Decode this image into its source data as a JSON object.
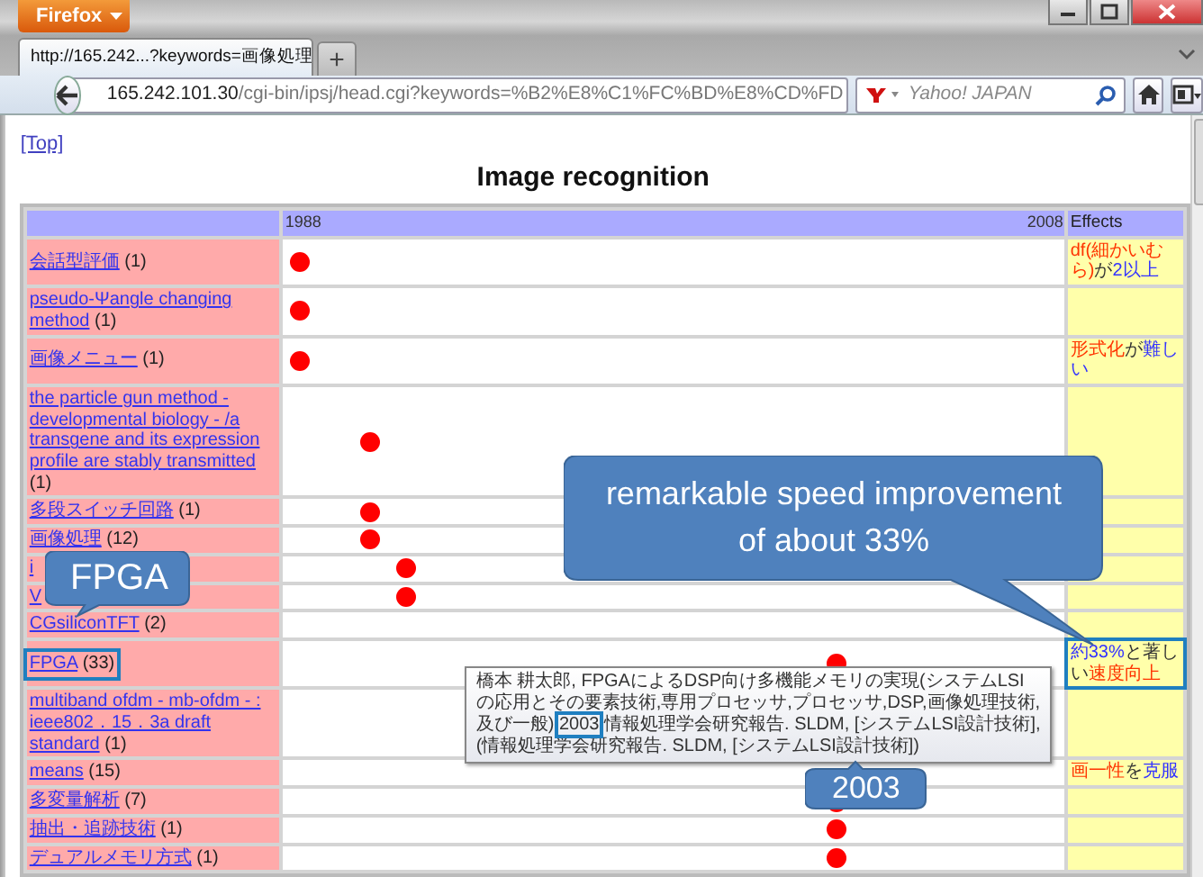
{
  "browser": {
    "menu_button": "Firefox",
    "tab": {
      "title": "http://165.242...?keywords=画像処理",
      "selected": true
    },
    "new_tab": "+",
    "url": {
      "host": "165.242.101.30",
      "path": "/cgi-bin/ipsj/head.cgi?keywords=%B2%E8%C1%FC%BD%E8%CD%FD"
    },
    "search": {
      "placeholder": "Yahoo! JAPAN"
    }
  },
  "page": {
    "top_link": "[Top]",
    "title": "Image recognition",
    "table": {
      "timeline_start": "1988",
      "timeline_end": "2008",
      "effects_heading": "Effects",
      "rows": [
        {
          "topic": "会話型評価",
          "count": "(1)",
          "level": 0.02,
          "highlighted": false,
          "effect": [
            {
              "text": "df(細かいむら)",
              "color": "#ff3300"
            },
            {
              "text": "が",
              "color": "#333333"
            },
            {
              "text": "2以上",
              "color": "#3333ff"
            }
          ]
        },
        {
          "topic": "pseudo-Ψangle changing method",
          "count": "(1)",
          "level": 0.02,
          "highlighted": false
        },
        {
          "topic": "画像メニュー",
          "count": "(1)",
          "level": 0.02,
          "highlighted": false,
          "effect": [
            {
              "text": "形式化",
              "color": "#ff3300"
            },
            {
              "text": "が",
              "color": "#333333"
            },
            {
              "text": "難しい",
              "color": "#3333ff"
            }
          ]
        },
        {
          "topic": "the particle gun method - developmental biology - /a transgene and its expression profile are stably transmitted",
          "count": "(1)",
          "level": 0.11,
          "highlighted": false
        },
        {
          "topic": "多段スイッチ回路",
          "count": "(1)",
          "level": 0.11,
          "highlighted": false
        },
        {
          "topic": "画像処理",
          "count": "(12)",
          "level": 0.11,
          "highlighted": false
        },
        {
          "topic": "i",
          "level": 0.157,
          "highlighted": false
        },
        {
          "topic": "V",
          "level": 0.157,
          "highlighted": false
        },
        {
          "topic": "CGsiliconTFT",
          "count": "(2)",
          "highlighted": false
        },
        {
          "topic": "FPGA",
          "count": "(33)",
          "level": 0.707,
          "highlighted": true,
          "effect": [
            {
              "text": "約33%",
              "color": "#3333ff"
            },
            {
              "text": "と著しい",
              "color": "#333333"
            },
            {
              "text": "速度向上",
              "color": "#ff3300"
            }
          ]
        },
        {
          "topic": "multiband ofdm - mb-ofdm - : ieee802．15．3a draft standard",
          "count": "(1)",
          "highlighted": false
        },
        {
          "topic": "means",
          "count": "(15)",
          "highlighted": false,
          "effect": [
            {
              "text": "画一性",
              "color": "#ff3300"
            },
            {
              "text": "を",
              "color": "#333333"
            },
            {
              "text": "克服",
              "color": "#3333ff"
            }
          ]
        },
        {
          "topic": "多変量解析",
          "count": "(7)",
          "level": 0.707,
          "highlighted": false
        },
        {
          "topic": "抽出・追跡技術",
          "count": "(1)",
          "level": 0.707,
          "highlighted": false
        },
        {
          "topic": "デュアルメモリ方式",
          "count": "(1)",
          "level": 0.707,
          "highlighted": false
        }
      ]
    },
    "tooltip": {
      "before": "橋本 耕太郎, FPGAによるDSP向け多機能メモリの実現(システムLSIの応用とその要素技術,専用プロセッサ,プロセッサ,DSP,画像処理技術,及び一般)",
      "year": "2003",
      "year_highlighted": true,
      "after": "情報処理学会研究報告. SLDM, [システムLSI設計技術], (情報処理学会研究報告. SLDM, [システムLSI設計技術])"
    }
  },
  "callouts": [
    {
      "text": "remarkable speed improvement of about 33%"
    },
    {
      "text": "FPGA"
    },
    {
      "text": "2003"
    }
  ]
}
